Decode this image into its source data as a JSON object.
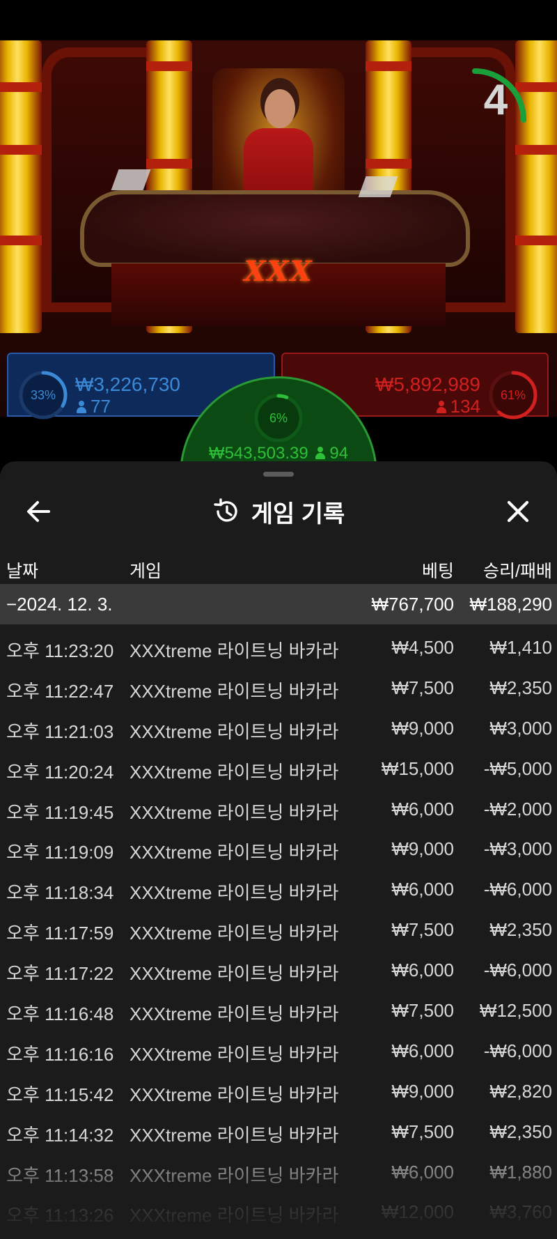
{
  "video": {
    "table_logo": "XXX",
    "countdown": "4",
    "countdown_fraction": 0.25
  },
  "bets": {
    "player": {
      "percent": "33%",
      "amount": "₩3,226,730",
      "count": "77",
      "color": "#3a8ad8"
    },
    "banker": {
      "percent": "61%",
      "amount": "₩5,892,989",
      "count": "134",
      "color": "#d02020"
    },
    "tie": {
      "percent": "6%",
      "amount": "₩543,503.39",
      "count": "94",
      "color": "#2fc03a"
    }
  },
  "history": {
    "title": "게임 기록",
    "columns": {
      "date": "날짜",
      "game": "게임",
      "bet": "베팅",
      "result": "승리/패배"
    },
    "date_group": {
      "date": "−2024. 12. 3.",
      "bet_total": "₩767,700",
      "result_total": "₩188,290"
    },
    "rows": [
      {
        "time": "오후 11:23:20",
        "game": "XXXtreme 라이트닝 바카라",
        "bet": "₩4,500",
        "result": "₩1,410"
      },
      {
        "time": "오후 11:22:47",
        "game": "XXXtreme 라이트닝 바카라",
        "bet": "₩7,500",
        "result": "₩2,350"
      },
      {
        "time": "오후 11:21:03",
        "game": "XXXtreme 라이트닝 바카라",
        "bet": "₩9,000",
        "result": "₩3,000"
      },
      {
        "time": "오후 11:20:24",
        "game": "XXXtreme 라이트닝 바카라",
        "bet": "₩15,000",
        "result": "-₩5,000"
      },
      {
        "time": "오후 11:19:45",
        "game": "XXXtreme 라이트닝 바카라",
        "bet": "₩6,000",
        "result": "-₩2,000"
      },
      {
        "time": "오후 11:19:09",
        "game": "XXXtreme 라이트닝 바카라",
        "bet": "₩9,000",
        "result": "-₩3,000"
      },
      {
        "time": "오후 11:18:34",
        "game": "XXXtreme 라이트닝 바카라",
        "bet": "₩6,000",
        "result": "-₩6,000"
      },
      {
        "time": "오후 11:17:59",
        "game": "XXXtreme 라이트닝 바카라",
        "bet": "₩7,500",
        "result": "₩2,350"
      },
      {
        "time": "오후 11:17:22",
        "game": "XXXtreme 라이트닝 바카라",
        "bet": "₩6,000",
        "result": "-₩6,000"
      },
      {
        "time": "오후 11:16:48",
        "game": "XXXtreme 라이트닝 바카라",
        "bet": "₩7,500",
        "result": "₩12,500"
      },
      {
        "time": "오후 11:16:16",
        "game": "XXXtreme 라이트닝 바카라",
        "bet": "₩6,000",
        "result": "-₩6,000"
      },
      {
        "time": "오후 11:15:42",
        "game": "XXXtreme 라이트닝 바카라",
        "bet": "₩9,000",
        "result": "₩2,820"
      },
      {
        "time": "오후 11:14:32",
        "game": "XXXtreme 라이트닝 바카라",
        "bet": "₩7,500",
        "result": "₩2,350"
      },
      {
        "time": "오후 11:13:58",
        "game": "XXXtreme 라이트닝 바카라",
        "bet": "₩6,000",
        "result": "₩1,880"
      },
      {
        "time": "오후 11:13:26",
        "game": "XXXtreme 라이트닝 바카라",
        "bet": "₩12,000",
        "result": "₩3,760"
      }
    ]
  },
  "icons": {
    "back": "arrow-left-icon",
    "history": "history-icon",
    "close": "close-icon",
    "person": "person-icon"
  }
}
